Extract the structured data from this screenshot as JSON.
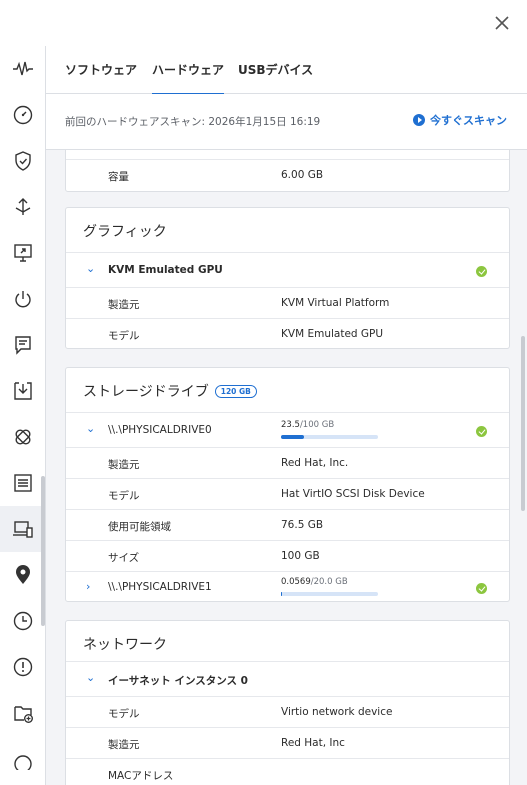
{
  "window": {
    "close_label": "×"
  },
  "tabs": [
    {
      "label": "ソフトウェア"
    },
    {
      "label": "ハードウェア"
    },
    {
      "label": "USBデバイス"
    }
  ],
  "scan": {
    "last_scan_text": "前回のハードウェアスキャン: 2026年1月15日 16:19",
    "scan_now_label": "今すぐスキャン"
  },
  "memory_partial": {
    "capacity_key": "容量",
    "capacity_value": "6.00 GB"
  },
  "graphics": {
    "title": "グラフィック",
    "device_name": "KVM Emulated GPU",
    "rows": [
      {
        "k": "製造元",
        "v": "KVM Virtual Platform"
      },
      {
        "k": "モデル",
        "v": "KVM Emulated GPU"
      }
    ]
  },
  "storage": {
    "title": "ストレージドライブ",
    "badge": "120 GB",
    "drive0": {
      "name": "\\\\.\\PHYSICALDRIVE0",
      "used": "23.5",
      "total": "/100 GB",
      "used_fraction": 0.235,
      "rows": [
        {
          "k": "製造元",
          "v": "Red Hat, Inc."
        },
        {
          "k": "モデル",
          "v": "Hat VirtIO SCSI Disk Device"
        },
        {
          "k": "使用可能領域",
          "v": "76.5 GB"
        },
        {
          "k": "サイズ",
          "v": "100 GB"
        }
      ]
    },
    "drive1": {
      "name": "\\\\.\\PHYSICALDRIVE1",
      "used": "0.0569",
      "total": "/20.0 GB",
      "used_fraction": 0.003
    }
  },
  "network": {
    "title": "ネットワーク",
    "device_name": "イーサネット インスタンス 0",
    "rows": [
      {
        "k": "モデル",
        "v": "Virtio network device"
      },
      {
        "k": "製造元",
        "v": "Red Hat, Inc"
      },
      {
        "k": "MACアドレス",
        "v": ""
      }
    ]
  },
  "colors": {
    "accent": "#1f6fd1",
    "ok": "#8cc63f",
    "background": "#f3f4f7"
  },
  "sidebar_icons": [
    "activity-icon",
    "speedometer-icon",
    "shield-check-icon",
    "transfer-arrows-icon",
    "remote-screen-icon",
    "power-icon",
    "notes-icon",
    "download-tray-icon",
    "patch-icon",
    "report-icon",
    "devices-icon",
    "location-pin-icon",
    "clock-icon",
    "alert-icon",
    "folder-add-icon",
    "more-icon"
  ]
}
